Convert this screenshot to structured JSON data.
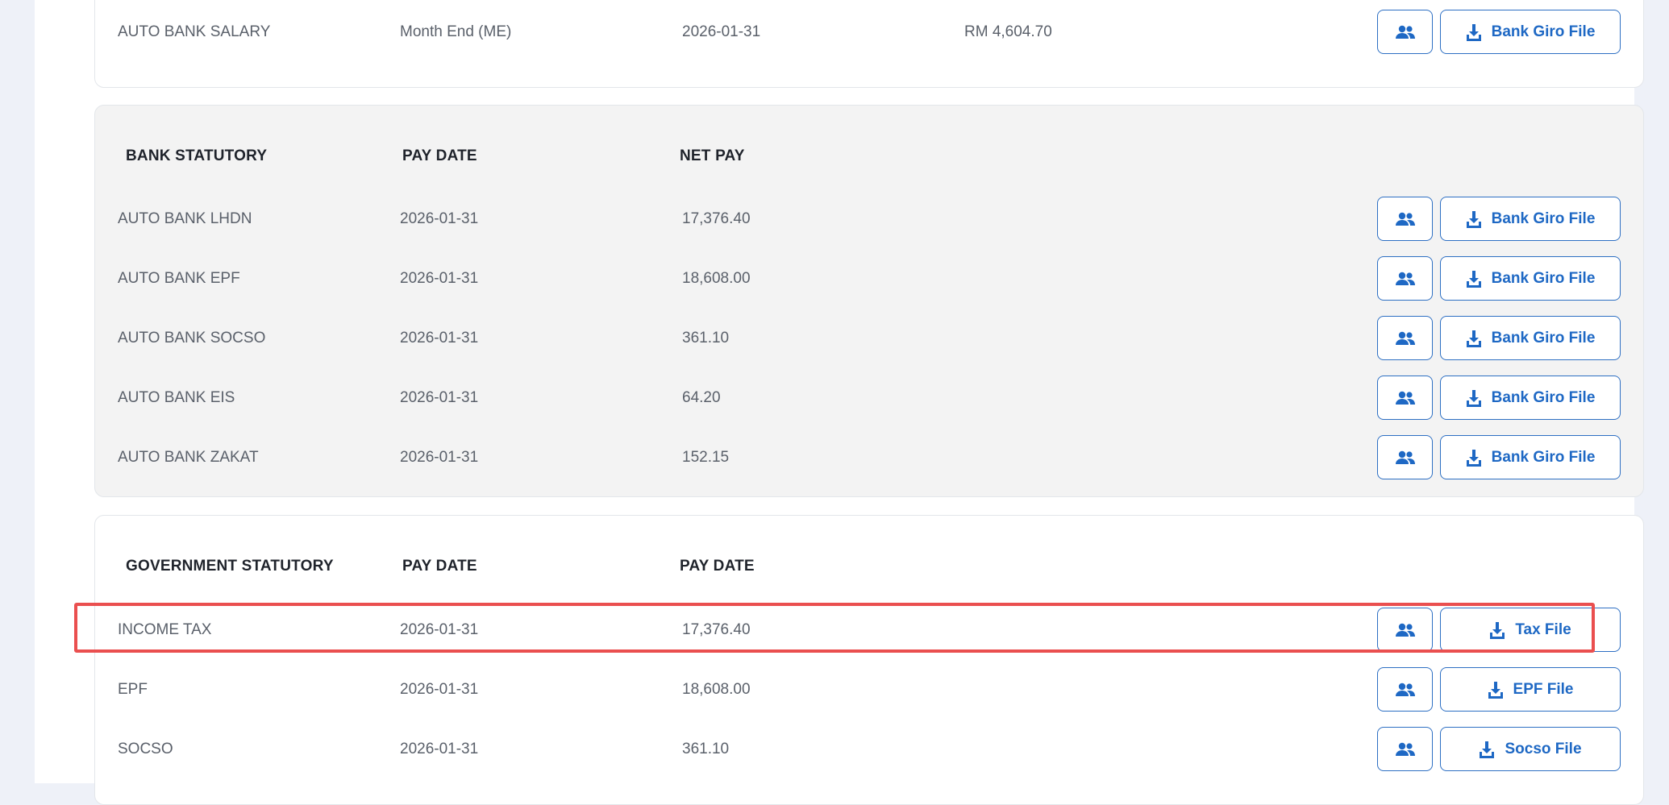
{
  "salary_section": {
    "row": {
      "name": "AUTO BANK SALARY",
      "type": "Month End (ME)",
      "pay_date": "2026-01-31",
      "amount": "RM 4,604.70",
      "file_button": "Bank Giro File"
    }
  },
  "bank_statutory": {
    "headers": {
      "col1": "BANK STATUTORY",
      "col2": "PAY DATE",
      "col3": "NET PAY"
    },
    "rows": [
      {
        "name": "AUTO BANK LHDN",
        "pay_date": "2026-01-31",
        "net_pay": "17,376.40",
        "file_button": "Bank Giro File"
      },
      {
        "name": "AUTO BANK EPF",
        "pay_date": "2026-01-31",
        "net_pay": "18,608.00",
        "file_button": "Bank Giro File"
      },
      {
        "name": "AUTO BANK SOCSO",
        "pay_date": "2026-01-31",
        "net_pay": "361.10",
        "file_button": "Bank Giro File"
      },
      {
        "name": "AUTO BANK EIS",
        "pay_date": "2026-01-31",
        "net_pay": "64.20",
        "file_button": "Bank Giro File"
      },
      {
        "name": "AUTO BANK ZAKAT",
        "pay_date": "2026-01-31",
        "net_pay": "152.15",
        "file_button": "Bank Giro File"
      }
    ]
  },
  "government_statutory": {
    "headers": {
      "col1": "GOVERNMENT STATUTORY",
      "col2": "PAY DATE",
      "col3": "PAY DATE"
    },
    "rows": [
      {
        "name": "INCOME TAX",
        "pay_date": "2026-01-31",
        "amount": "17,376.40",
        "file_button": "Tax File"
      },
      {
        "name": "EPF",
        "pay_date": "2026-01-31",
        "amount": "18,608.00",
        "file_button": "EPF File"
      },
      {
        "name": "SOCSO",
        "pay_date": "2026-01-31",
        "amount": "361.10",
        "file_button": "Socso File"
      }
    ]
  },
  "icons": {
    "employees": "users-icon",
    "download": "download-icon"
  },
  "colors": {
    "accent": "#1e68c4",
    "highlight": "#ea4f4f",
    "section_gray": "#f3f3f3"
  }
}
